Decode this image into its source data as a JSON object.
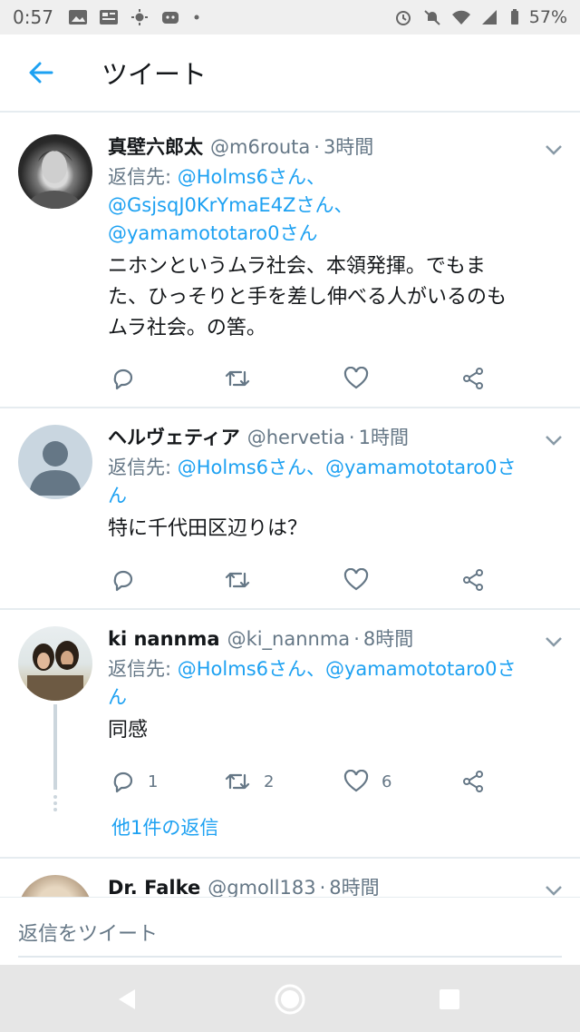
{
  "status_bar": {
    "time": "0:57",
    "battery": "57%"
  },
  "app_bar": {
    "title": "ツイート"
  },
  "tweets": [
    {
      "name": "真壁六郎太",
      "handle": "@m6routa",
      "sep": "·",
      "time": "3時間",
      "reply_prefix": "返信先: ",
      "reply_line1": "@Holms6さん、",
      "reply_line2": "@GsjsqJ0KrYmaE4Zさん、",
      "reply_line3": "@yamamototaro0さん",
      "text_line1": "ニホンというムラ社会、本領発揮。でもま",
      "text_line2": "た、ひっそりと手を差し伸べる人がいるのも",
      "text_line3": "ムラ社会。の筈。"
    },
    {
      "name": "ヘルヴェティア",
      "handle": "@hervetia",
      "sep": "·",
      "time": "1時間",
      "reply_prefix": "返信先: ",
      "reply_line1": "@Holms6さん、@yamamototaro0さ",
      "reply_line2": "ん",
      "text_line1": "特に千代田区辺りは？"
    },
    {
      "name": "ki nannma",
      "handle": "@ki_nannma",
      "sep": "·",
      "time": "8時間",
      "reply_prefix": "返信先: ",
      "reply_line1": "@Holms6さん、@yamamototaro0さ",
      "reply_line2": "ん",
      "text_line1": "同感",
      "reply_count": "1",
      "retweet_count": "2",
      "like_count": "6",
      "more_replies": "他1件の返信"
    },
    {
      "name": "Dr. Falke",
      "handle": "@gmoll183",
      "sep": "·",
      "time": "8時間"
    }
  ],
  "composer": {
    "placeholder": "返信をツイート"
  },
  "colors": {
    "accent": "#1da1f2",
    "muted": "#657786",
    "divider": "#e6ecf0"
  }
}
